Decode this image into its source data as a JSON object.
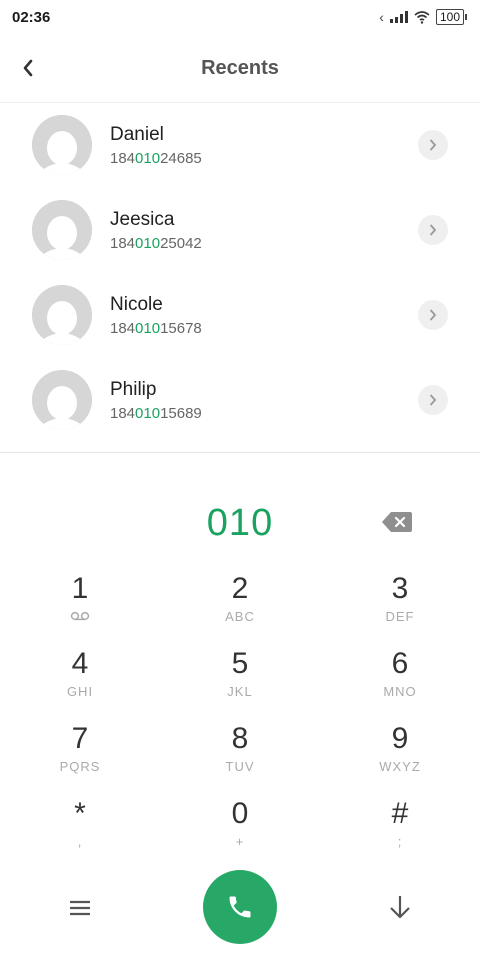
{
  "status_bar": {
    "time": "02:36",
    "battery": "100"
  },
  "header": {
    "title": "Recents"
  },
  "recents": [
    {
      "name": "Daniel",
      "number_prefix": "184",
      "number_match": "010",
      "number_suffix": "24685"
    },
    {
      "name": "Jeesica",
      "number_prefix": "184",
      "number_match": "010",
      "number_suffix": "25042"
    },
    {
      "name": "Nicole",
      "number_prefix": "184",
      "number_match": "010",
      "number_suffix": "15678"
    },
    {
      "name": "Philip",
      "number_prefix": "184",
      "number_match": "010",
      "number_suffix": "15689"
    }
  ],
  "dialer": {
    "input": "010"
  },
  "keypad": [
    {
      "digit": "1",
      "letters": ""
    },
    {
      "digit": "2",
      "letters": "ABC"
    },
    {
      "digit": "3",
      "letters": "DEF"
    },
    {
      "digit": "4",
      "letters": "GHI"
    },
    {
      "digit": "5",
      "letters": "JKL"
    },
    {
      "digit": "6",
      "letters": "MNO"
    },
    {
      "digit": "7",
      "letters": "PQRS"
    },
    {
      "digit": "8",
      "letters": "TUV"
    },
    {
      "digit": "9",
      "letters": "WXYZ"
    },
    {
      "digit": "*",
      "letters": ","
    },
    {
      "digit": "0",
      "letters": "+"
    },
    {
      "digit": "#",
      "letters": ";"
    }
  ],
  "colors": {
    "accent": "#1aa260",
    "call_button": "#27a866"
  },
  "icons": {
    "back": "chevron-left-icon",
    "detail": "chevron-right-icon",
    "backspace": "backspace-icon",
    "voicemail": "voicemail-icon",
    "menu": "menu-icon",
    "call": "phone-icon",
    "collapse": "arrow-down-icon"
  }
}
